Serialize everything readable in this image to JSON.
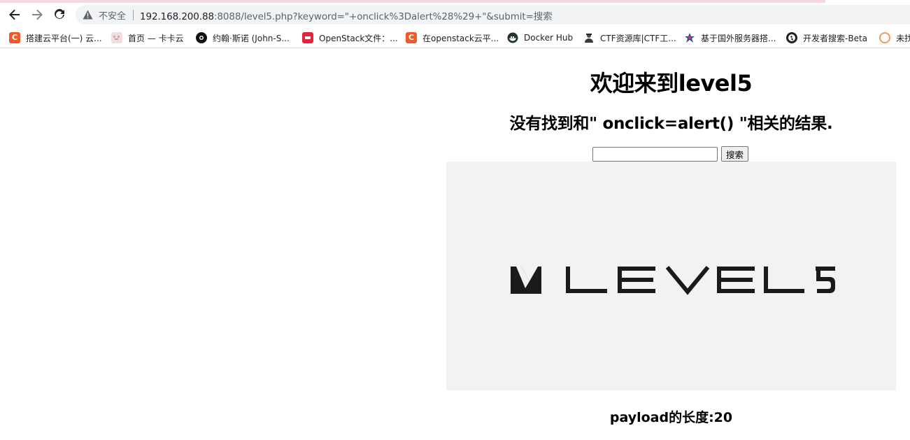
{
  "browser": {
    "security_label": "不安全",
    "url_host": "192.168.200.88",
    "url_rest": ":8088/level5.php?keyword=\"+onclick%3Dalert%28%29+\"&submit=搜索"
  },
  "bookmarks": [
    {
      "label": "搭建云平台(一) 云...",
      "icon": "csdn-icon"
    },
    {
      "label": "首页 — 卡卡云",
      "icon": "kaka-icon"
    },
    {
      "label": "约翰·斯诺 (John-S...",
      "icon": "github-icon"
    },
    {
      "label": "OpenStack文件：...",
      "icon": "openstack-icon"
    },
    {
      "label": "在openstack云平...",
      "icon": "csdn-icon"
    },
    {
      "label": "Docker Hub",
      "icon": "docker-icon"
    },
    {
      "label": "CTF资源库|CTF工...",
      "icon": "ctf-icon"
    },
    {
      "label": "基于国外服务器搭...",
      "icon": "star-icon"
    },
    {
      "label": "开发者搜索-Beta",
      "icon": "globe-icon"
    },
    {
      "label": "未找",
      "icon": "ring-icon"
    }
  ],
  "page": {
    "welcome": "欢迎来到level5",
    "result_text": "没有找到和\" onclick=alert() \"相关的结果.",
    "search_value": "",
    "search_button": "搜索",
    "banner_text": "LEVEL5",
    "payload_length": "payload的长度:20"
  },
  "colors": {
    "banner_bg": "#f2f2f2",
    "logo": "#1a1a1a"
  }
}
